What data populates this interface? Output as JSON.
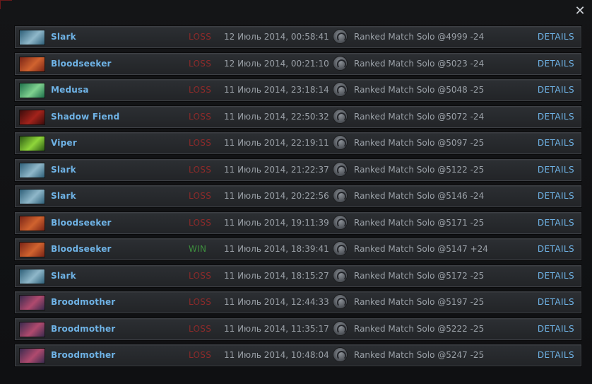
{
  "close_icon": "close-icon",
  "matches": [
    {
      "hero": "Slark",
      "result": "LOSS",
      "date": "12 Июль 2014, 00:58:41",
      "mode": "Ranked Match Solo @4999 -24",
      "details": "DETAILS"
    },
    {
      "hero": "Bloodseeker",
      "result": "LOSS",
      "date": "12 Июль 2014, 00:21:10",
      "mode": "Ranked Match Solo @5023 -24",
      "details": "DETAILS"
    },
    {
      "hero": "Medusa",
      "result": "LOSS",
      "date": "11 Июль 2014, 23:18:14",
      "mode": "Ranked Match Solo @5048 -25",
      "details": "DETAILS"
    },
    {
      "hero": "Shadow Fiend",
      "result": "LOSS",
      "date": "11 Июль 2014, 22:50:32",
      "mode": "Ranked Match Solo @5072 -24",
      "details": "DETAILS"
    },
    {
      "hero": "Viper",
      "result": "LOSS",
      "date": "11 Июль 2014, 22:19:11",
      "mode": "Ranked Match Solo @5097 -25",
      "details": "DETAILS"
    },
    {
      "hero": "Slark",
      "result": "LOSS",
      "date": "11 Июль 2014, 21:22:37",
      "mode": "Ranked Match Solo @5122 -25",
      "details": "DETAILS"
    },
    {
      "hero": "Slark",
      "result": "LOSS",
      "date": "11 Июль 2014, 20:22:56",
      "mode": "Ranked Match Solo @5146 -24",
      "details": "DETAILS"
    },
    {
      "hero": "Bloodseeker",
      "result": "LOSS",
      "date": "11 Июль 2014, 19:11:39",
      "mode": "Ranked Match Solo @5171 -25",
      "details": "DETAILS"
    },
    {
      "hero": "Bloodseeker",
      "result": "WIN",
      "date": "11 Июль 2014, 18:39:41",
      "mode": "Ranked Match Solo @5147 +24",
      "details": "DETAILS"
    },
    {
      "hero": "Slark",
      "result": "LOSS",
      "date": "11 Июль 2014, 18:15:27",
      "mode": "Ranked Match Solo @5172 -25",
      "details": "DETAILS"
    },
    {
      "hero": "Broodmother",
      "result": "LOSS",
      "date": "11 Июль 2014, 12:44:33",
      "mode": "Ranked Match Solo @5197 -25",
      "details": "DETAILS"
    },
    {
      "hero": "Broodmother",
      "result": "LOSS",
      "date": "11 Июль 2014, 11:35:17",
      "mode": "Ranked Match Solo @5222 -25",
      "details": "DETAILS"
    },
    {
      "hero": "Broodmother",
      "result": "LOSS",
      "date": "11 Июль 2014, 10:48:04",
      "mode": "Ranked Match Solo @5247 -25",
      "details": "DETAILS"
    }
  ],
  "hero_colors": {
    "Slark": [
      "#2e5f78",
      "#8fb7c9"
    ],
    "Bloodseeker": [
      "#7a2416",
      "#d0632f"
    ],
    "Medusa": [
      "#1d6f4a",
      "#7fd18f"
    ],
    "Shadow Fiend": [
      "#3a0b0b",
      "#a3231b"
    ],
    "Viper": [
      "#2c5a14",
      "#8fd63a"
    ],
    "Broodmother": [
      "#3a2a4e",
      "#b04a6e"
    ]
  },
  "colors": {
    "hero_name": "#6fb3e6",
    "loss": "#8e2a2a",
    "win": "#3e8f3e",
    "details": "#6fb3e6"
  }
}
